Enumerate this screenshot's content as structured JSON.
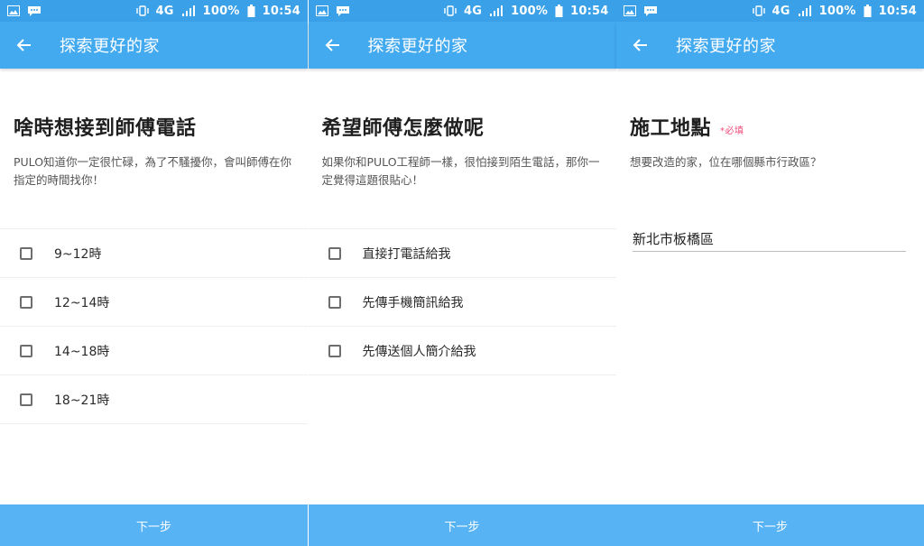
{
  "status": {
    "battery": "100%",
    "time": "10:54",
    "network": "4G"
  },
  "app": {
    "title": "探索更好的家",
    "next_label": "下一步"
  },
  "screens": [
    {
      "heading": "啥時想接到師傅電話",
      "description": "PULO知道你一定很忙碌，為了不騷擾你，會叫師傅在你指定的時間找你！",
      "options": [
        "9~12時",
        "12~14時",
        "14~18時",
        "18~21時"
      ]
    },
    {
      "heading": "希望師傅怎麼做呢",
      "description": "如果你和PULO工程師一樣，很怕接到陌生電話，那你一定覺得這題很貼心！",
      "options": [
        "直接打電話給我",
        "先傳手機簡訊給我",
        "先傳送個人簡介給我"
      ]
    },
    {
      "heading": "施工地點",
      "required_label": "*必填",
      "description": "想要改造的家，位在哪個縣市行政區？",
      "input_value": "新北市板橋區"
    }
  ],
  "colors": {
    "appbar": "#43aaf0",
    "statusbar": "#3aa0e8",
    "next_button": "#58b3f5",
    "required": "#ee4a7a"
  },
  "icons": [
    "image-icon",
    "message-icon",
    "vibrate-icon",
    "signal-icon",
    "battery-icon",
    "back-arrow-icon"
  ]
}
